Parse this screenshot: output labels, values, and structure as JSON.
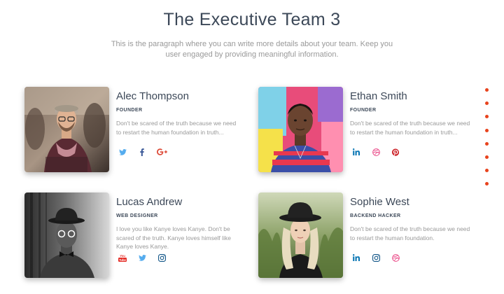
{
  "header": {
    "title": "The Executive Team 3",
    "subtitle": "This is the paragraph where you can write more details about your team. Keep you user engaged by providing meaningful information."
  },
  "team": [
    {
      "name": "Alec Thompson",
      "role": "FOUNDER",
      "description": "Don't be scared of the truth because we need to restart the human foundation in truth...",
      "socials": [
        "twitter-icon",
        "facebook-icon",
        "google-plus-icon"
      ]
    },
    {
      "name": "Ethan Smith",
      "role": "FOUNDER",
      "description": "Don't be scared of the truth because we need to restart the human foundation in truth...",
      "socials": [
        "linkedin-icon",
        "dribbble-icon",
        "pinterest-icon"
      ]
    },
    {
      "name": "Lucas Andrew",
      "role": "WEB DESIGNER",
      "description": "I love you like Kanye loves Kanye. Don't be scared of the truth. Kanye loves himself like Kanye loves Kanye.",
      "socials": [
        "youtube-icon",
        "twitter-icon",
        "instagram-icon"
      ]
    },
    {
      "name": "Sophie West",
      "role": "BACKEND HACKER",
      "description": "Don't be scared of the truth because we need to restart the human foundation.",
      "socials": [
        "linkedin-icon",
        "instagram-icon",
        "dribbble-icon"
      ]
    }
  ],
  "social_colors": {
    "twitter": "#55acee",
    "facebook": "#3b5998",
    "google_plus": "#dd4b39",
    "linkedin": "#0976b4",
    "dribbble": "#ea4c89",
    "pinterest": "#cc2127",
    "youtube": "#e52d27",
    "instagram": "#125688"
  },
  "nav_dots": {
    "count": 8,
    "color": "#e8431d"
  }
}
